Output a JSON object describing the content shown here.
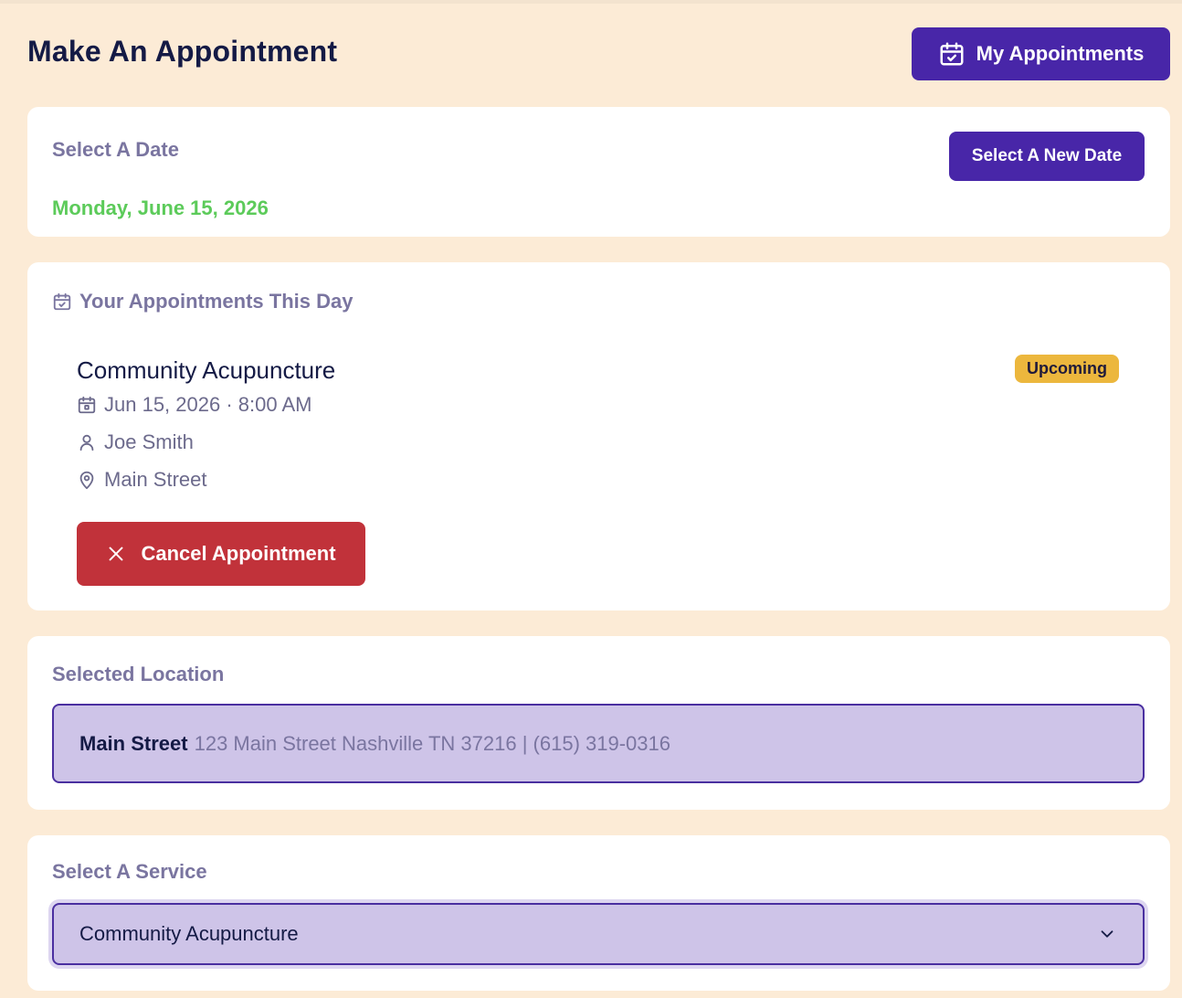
{
  "header": {
    "title": "Make An Appointment",
    "my_appointments_label": "My Appointments"
  },
  "date_section": {
    "label": "Select A Date",
    "selected_date": "Monday, June 15, 2026",
    "new_date_label": "Select A New Date"
  },
  "appointments_section": {
    "label": "Your Appointments This Day",
    "appointment": {
      "service": "Community Acupuncture",
      "status": "Upcoming",
      "datetime": "Jun 15, 2026 · 8:00 AM",
      "provider": "Joe Smith",
      "location": "Main Street",
      "cancel_label": "Cancel Appointment"
    }
  },
  "location_section": {
    "label": "Selected Location",
    "name": "Main Street",
    "details": "123 Main Street Nashville TN 37216 | (615) 319-0316"
  },
  "service_section": {
    "label": "Select A Service",
    "selected": "Community Acupuncture"
  },
  "colors": {
    "background": "#fcebd6",
    "primary": "#4826a8",
    "danger": "#c1323a",
    "success": "#5ccb5a",
    "badge": "#ecb73d",
    "field": "#cec4e8"
  },
  "icons": {
    "my_appointments": "calendar-check-icon",
    "appointments_heading": "calendar-check-icon",
    "datetime": "calendar-icon",
    "provider": "user-icon",
    "location": "map-pin-icon",
    "cancel": "close-icon",
    "dropdown": "chevron-down-icon"
  }
}
